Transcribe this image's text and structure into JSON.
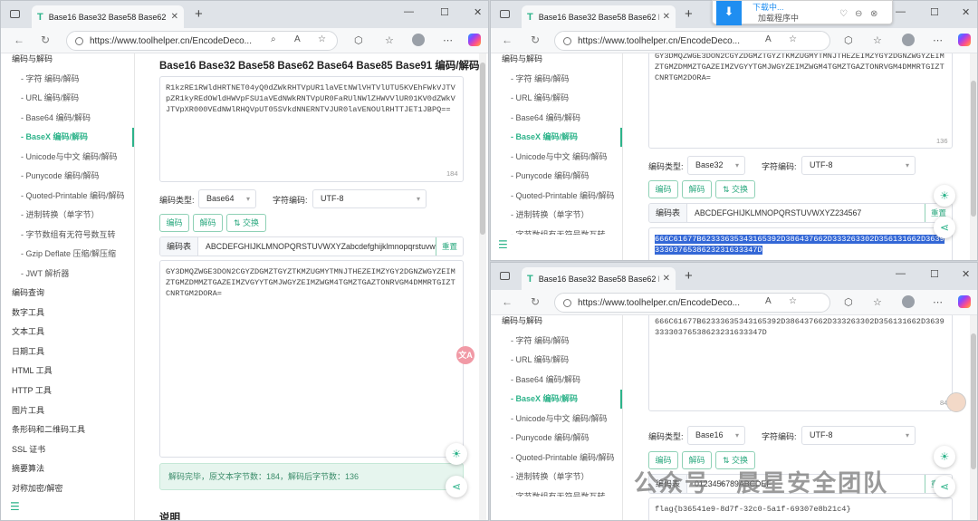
{
  "browser": {
    "tab_title": "Base16 Base32 Base58 Base62 Base64 Base85 Base91 编码/解码",
    "url": "https://www.toolhelper.cn/EncodeDecode/BaseX",
    "url_short": "https://www.toolhelper.cn/EncodeDeco..."
  },
  "sidebar": {
    "top": "编码与解码",
    "items": [
      "- 字符  编码/解码",
      "- URL  编码/解码",
      "- Base64  编码/解码",
      "- BaseX  编码/解码",
      "- Unicode与中文  编码/解码",
      "- Punycode  编码/解码",
      "- Quoted-Printable  编码/解码",
      "- 进制转换（单字节）",
      "- 字节数组有无符号数互转",
      "- Gzip Deflate 压缩/解压缩",
      "- JWT 解析器"
    ],
    "groups": [
      "编码查询",
      "数字工具",
      "文本工具",
      "日期工具",
      "HTML 工具",
      "HTTP 工具",
      "图片工具",
      "条形码和二维码工具",
      "SSL 证书",
      "摘要算法",
      "对称加密/解密"
    ],
    "partial_item": "- 字节数组有无符号数互转"
  },
  "win1": {
    "heading": "Base16 Base32 Base58 Base62 Base64 Base85 Base91 编码/解码",
    "input_text": "R1kzRE1RWldHRTNET04yQ0dZWkRHTVpUR1laVEtNWlVHTVlUTU5KVEhFWkVJTVpZR1kyREdOWldHWVpFSU1aVEdNWkRNTVpUR0FaRUlNWlZHWVVlUR01KV0dZWkVJTVpXR000VEdNWlRHQVpUT05SVkdNNERNTVJUR0laVENOUlRHTTJET1JBPQ==",
    "input_count": "184",
    "enc_type_label": "编码类型:",
    "enc_type": "Base64",
    "charset_label": "字符编码:",
    "charset": "UTF-8",
    "btn_encode": "编码",
    "btn_decode": "解码",
    "btn_swap": "⇅ 交换",
    "alphabet_label": "编码表",
    "alphabet": "ABCDEFGHIJKLMNOPQRSTUVWXYZabcdefghijklmnopqrstuvwxyz0123456789+/",
    "reset": "重置",
    "output_text": "GY3DMQZWGE3DON2CGYZDGMZTGYZTKMZUGMYTMNJTHEZEIMZYGY2DGNZWGYZEIMZTGMZDMMZTGAZEIMZVGYYTGMJWGYZEIMZWGM4TGMZTGAZTONRVGM4DMMRTGIZTCNRTGM2DORA=",
    "status": "解码完毕，原文本字节数：184，解码后字节数：136",
    "cut_heading": "说明"
  },
  "win2": {
    "top_text": "GY3DMQZWGE3DON2CGYZDGMZTGYZTKMZUGMYTMNJTHEZEIMZYGY2DGNZWGYZEIMZTGMZDMMZTGAZEIMZVGYYTGMJWGYZEIMZWGM4TGMZTGAZTONRVGM4DMMRTGIZTCNRTGM2DORA=",
    "count": "136",
    "enc_type": "Base32",
    "alphabet": "ABCDEFGHIJKLMNOPQRSTUVWXYZ234567",
    "output_sel": "666C61677B62333635343165392D386437662D333263302D356131662D36393330376538623231633347D"
  },
  "win3": {
    "top_text": "666C61677B62333635343165392D386437662D333263302D356131662D363933330376538623231633347D",
    "count": "84",
    "enc_type": "Base16",
    "alphabet": "0123456789ABCDEF",
    "output": "flag{b36541e9-8d7f-32c0-5a1f-69307e8b21c4}"
  },
  "download": {
    "text": "下载中...",
    "sub": "加载程序中"
  },
  "watermark": "公众号 · 晨星安全团队"
}
